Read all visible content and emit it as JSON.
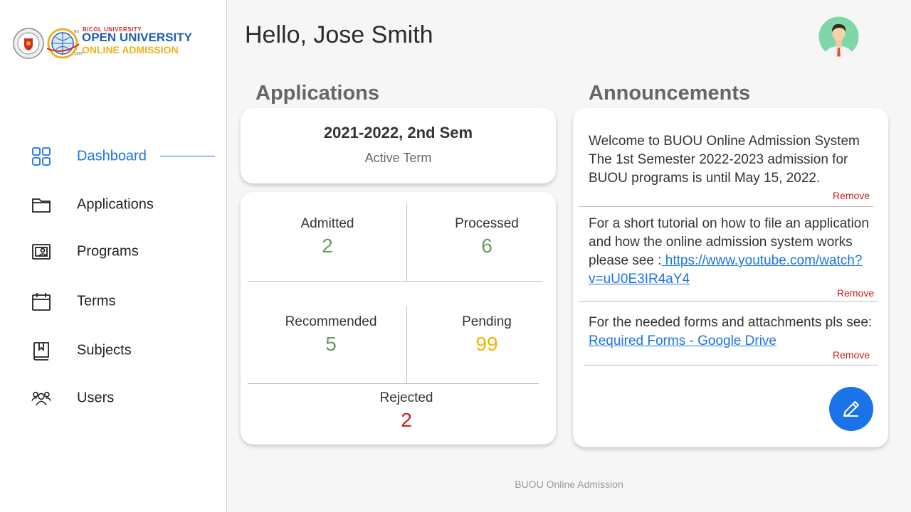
{
  "brand": {
    "line1": "BICOL UNIVERSITY",
    "line2": "OPEN UNIVERSITY",
    "line3": "ONLINE ADMISSION",
    "colors": {
      "blue": "#1f5fb5",
      "gold": "#f2b01e",
      "red": "#d12b2b"
    }
  },
  "sidebar": {
    "items": [
      {
        "label": "Dashboard",
        "icon": "grid-icon",
        "active": true
      },
      {
        "label": "Applications",
        "icon": "folder-icon"
      },
      {
        "label": "Programs",
        "icon": "presentation-icon"
      },
      {
        "label": "Terms",
        "icon": "calendar-icon"
      },
      {
        "label": "Subjects",
        "icon": "bookmark-book-icon"
      },
      {
        "label": "Users",
        "icon": "users-icon"
      }
    ]
  },
  "header": {
    "greeting": "Hello,  Jose Smith",
    "avatar_icon": "user-avatar-icon"
  },
  "applications": {
    "title": "Applications",
    "term": {
      "name": "2021-2022, 2nd Sem",
      "subtitle": "Active Term"
    },
    "stats": {
      "admitted": {
        "label": "Admitted",
        "value": "2"
      },
      "processed": {
        "label": "Processed",
        "value": "6"
      },
      "recommended": {
        "label": "Recommended",
        "value": "5"
      },
      "pending": {
        "label": "Pending",
        "value": "99"
      },
      "rejected": {
        "label": "Rejected",
        "value": "2"
      }
    }
  },
  "announcements": {
    "title": "Announcements",
    "remove_label": "Remove",
    "items": [
      {
        "text": "Welcome to BUOU Online Admission System The 1st Semester 2022-2023 admission for BUOU programs is until May 15, 2022."
      },
      {
        "text": "For a short tutorial on how to file an application and how the online admission system works please see :",
        "link": " https://www.youtube.com/watch?v=uU0E3IR4aY4"
      },
      {
        "text": "For the needed forms and attachments pls see: ",
        "link": "Required Forms - Google Drive"
      }
    ],
    "edit_icon": "pencil-icon"
  },
  "footer": {
    "text": "BUOU Online Admission"
  },
  "colors": {
    "accent": "#1a73e8",
    "green": "#6a9a5b",
    "yellow": "#f0b400",
    "red": "#c62020"
  }
}
